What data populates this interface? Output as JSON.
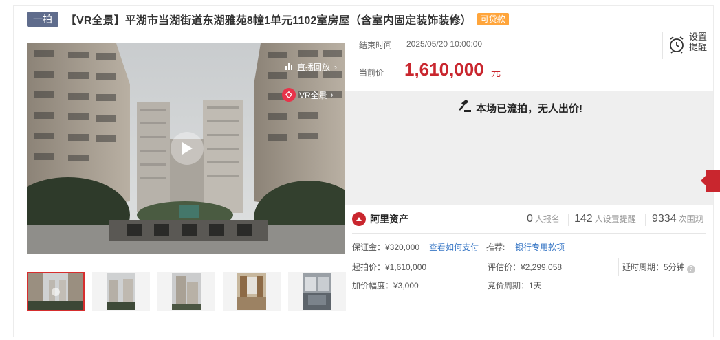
{
  "header": {
    "auction_round": "一拍",
    "title": "【VR全景】平湖市当湖街道东湖雅苑8幢1单元1102室房屋（含室内固定装饰装修）",
    "loan_tag": "可贷款"
  },
  "media": {
    "live_replay": "直播回放",
    "vr_label": "VR全景",
    "thumbnails": [
      "thumb-1",
      "thumb-2",
      "thumb-3",
      "thumb-4",
      "thumb-5"
    ]
  },
  "auction": {
    "end_label": "结束时间",
    "end_time": "2025/05/20 10:00:00",
    "price_label": "当前价",
    "current_price": "1,610,000",
    "currency_unit": "元",
    "reminder_label": "设置提醒",
    "status_message": "本场已流拍，无人出价!"
  },
  "platform": {
    "name": "阿里资产",
    "registrations_count": "0",
    "registrations_label": "人报名",
    "reminders_count": "142",
    "reminders_label": "人设置提醒",
    "views_count": "9334",
    "views_label": "次围观"
  },
  "details": {
    "deposit": "保证金：¥320,000",
    "deposit_link": "查看如何支付",
    "recommend_label": "推荐:",
    "recommend_link": "银行专用款项",
    "start_price": "起拍价：¥1,610,000",
    "appraisal": "评估价：¥2,299,058",
    "delay_period": "延时周期：5分钟",
    "increment": "加价幅度：¥3,000",
    "bid_period": "竞价周期：1天"
  },
  "colors": {
    "accent_red": "#c9262e",
    "link_blue": "#3a78c6",
    "tag_gray": "#5f6c8c",
    "tag_orange": "#ffa53b"
  }
}
